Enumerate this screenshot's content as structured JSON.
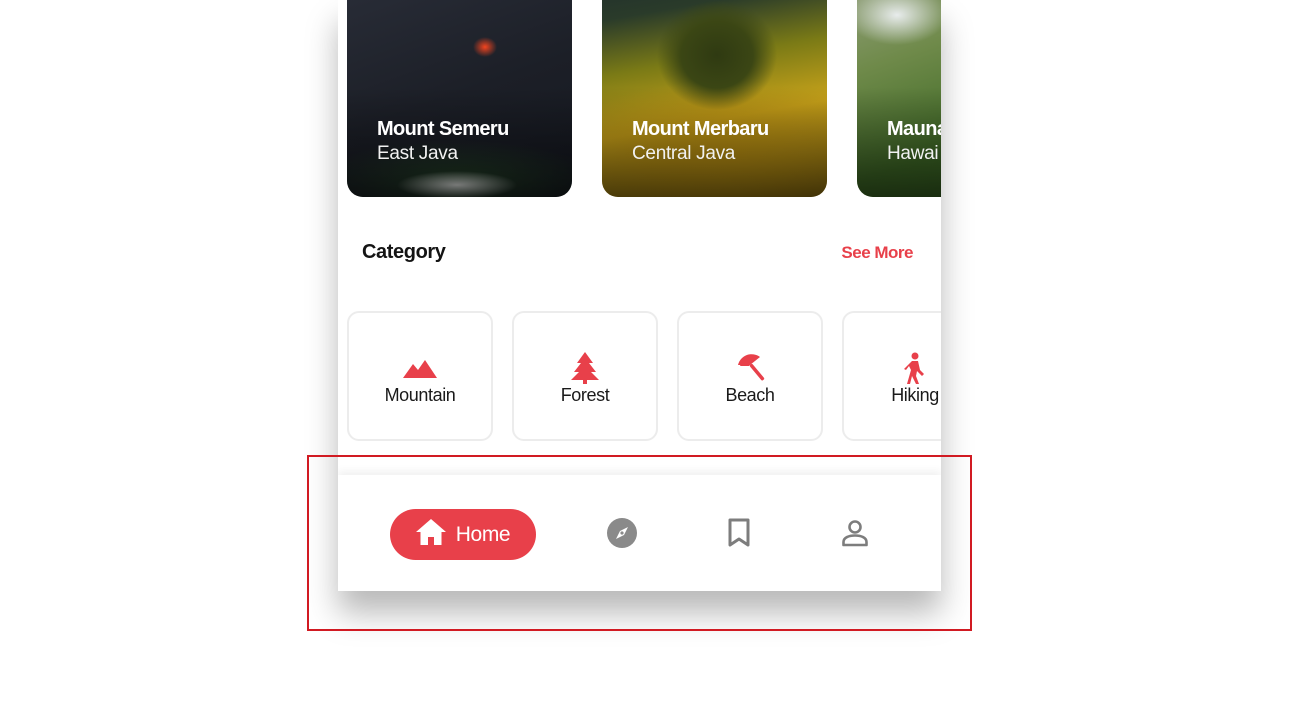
{
  "destinations": [
    {
      "name": "Mount Semeru",
      "region": "East Java"
    },
    {
      "name": "Mount Merbaru",
      "region": "Central Java"
    },
    {
      "name": "Mauna",
      "region": "Hawai"
    }
  ],
  "category_section": {
    "title": "Category",
    "see_more_label": "See More"
  },
  "categories": [
    {
      "label": "Mountain",
      "icon": "mountain-icon"
    },
    {
      "label": "Forest",
      "icon": "tree-icon"
    },
    {
      "label": "Beach",
      "icon": "umbrella-icon"
    },
    {
      "label": "Hiking",
      "icon": "hiker-icon"
    }
  ],
  "bottom_nav": {
    "home_label": "Home",
    "items": [
      {
        "icon": "home-icon",
        "active": true
      },
      {
        "icon": "compass-icon",
        "active": false
      },
      {
        "icon": "bookmark-icon",
        "active": false
      },
      {
        "icon": "person-icon",
        "active": false
      }
    ]
  },
  "colors": {
    "accent": "#e8404a",
    "icon_inactive": "#8a8a8a",
    "highlight_box": "#d11a22"
  }
}
